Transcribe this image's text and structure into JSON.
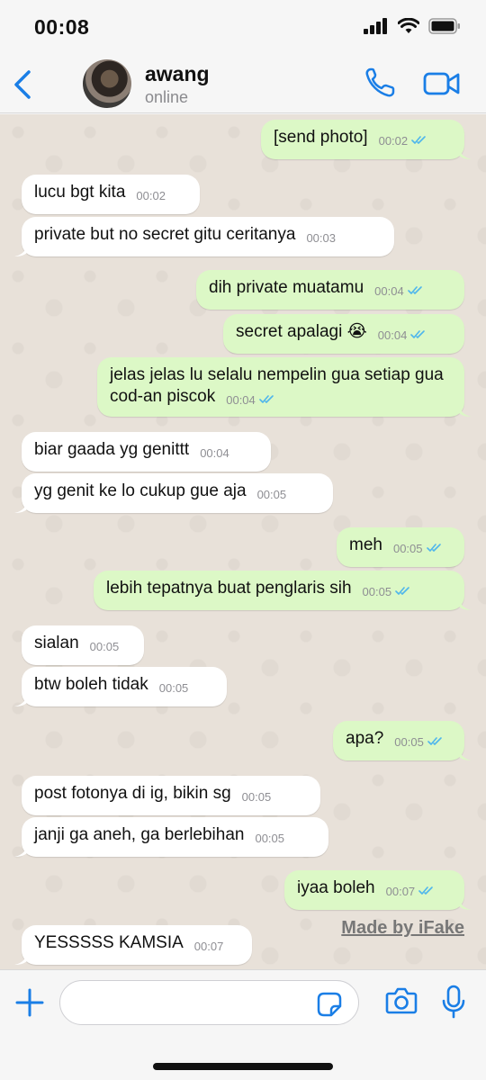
{
  "status_bar": {
    "time": "00:08"
  },
  "header": {
    "name": "awang",
    "status": "online"
  },
  "colors": {
    "accent": "#1a7ee6",
    "outgoing_bubble": "#dcf8c6",
    "incoming_bubble": "#ffffff",
    "read_check": "#4fb6ec"
  },
  "messages": [
    {
      "dir": "out",
      "text": "[send photo]",
      "time": "00:02",
      "read": true
    },
    {
      "dir": "in",
      "text": "lucu bgt kita",
      "time": "00:02"
    },
    {
      "dir": "in",
      "text": "private but no secret gitu ceritanya",
      "time": "00:03"
    },
    {
      "dir": "out",
      "text": "dih private muatamu",
      "time": "00:04",
      "read": true
    },
    {
      "dir": "out",
      "text": "secret apalagi 😭",
      "time": "00:04",
      "read": true
    },
    {
      "dir": "out",
      "text": "jelas jelas lu selalu nempelin gua setiap gua cod-an piscok",
      "time": "00:04",
      "read": true
    },
    {
      "dir": "in",
      "text": "biar gaada yg genittt",
      "time": "00:04"
    },
    {
      "dir": "in",
      "text": "yg genit ke lo cukup gue aja",
      "time": "00:05"
    },
    {
      "dir": "out",
      "text": "meh",
      "time": "00:05",
      "read": true
    },
    {
      "dir": "out",
      "text": "lebih tepatnya buat penglaris sih",
      "time": "00:05",
      "read": true
    },
    {
      "dir": "in",
      "text": "sialan",
      "time": "00:05"
    },
    {
      "dir": "in",
      "text": "btw boleh tidak",
      "time": "00:05"
    },
    {
      "dir": "out",
      "text": "apa?",
      "time": "00:05",
      "read": true
    },
    {
      "dir": "in",
      "text": "post fotonya di ig, bikin sg",
      "time": "00:05"
    },
    {
      "dir": "in",
      "text": "janji ga aneh, ga berlebihan",
      "time": "00:05"
    },
    {
      "dir": "out",
      "text": "iyaa boleh",
      "time": "00:07",
      "read": true
    },
    {
      "dir": "in",
      "text": "YESSSSS KAMSIA",
      "time": "00:07"
    }
  ],
  "watermark": "Made by iFake",
  "input": {
    "placeholder": ""
  },
  "icons": {
    "back": "chevron-left-icon",
    "call": "phone-icon",
    "video": "video-camera-icon",
    "plus": "plus-icon",
    "sticker": "sticker-icon",
    "camera": "camera-icon",
    "mic": "microphone-icon"
  }
}
